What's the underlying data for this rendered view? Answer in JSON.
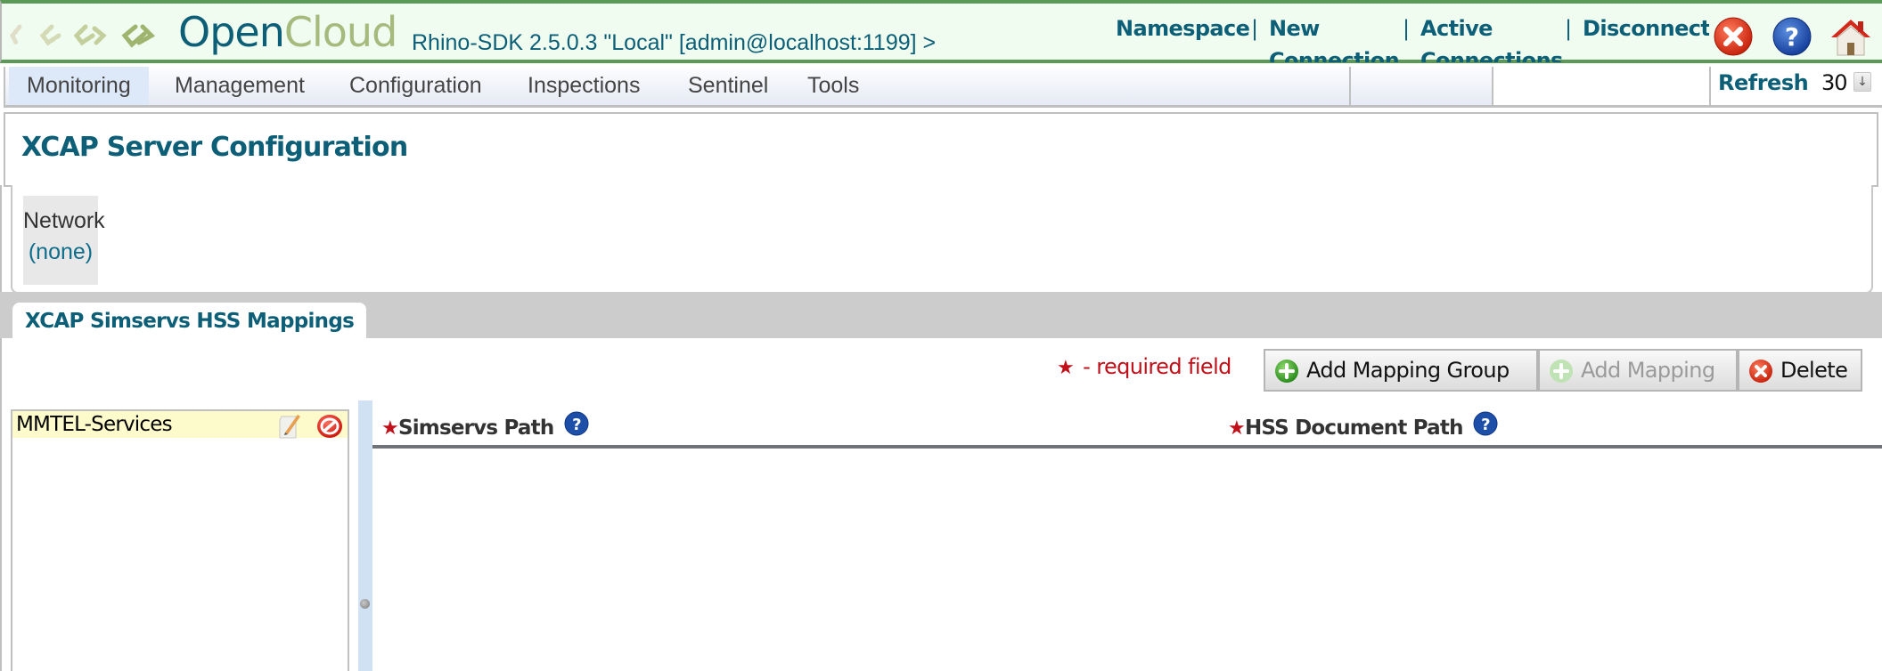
{
  "header": {
    "logo_open": "Open",
    "logo_cloud": "Cloud",
    "server_info": "Rhino-SDK 2.5.0.3 \"Local\" [admin@localhost:1199] >",
    "links": [
      {
        "label": "Namespace"
      },
      {
        "label": "New Connection"
      },
      {
        "label": "Active Connections"
      },
      {
        "label": "Disconnect"
      }
    ],
    "separator": "|",
    "icons": [
      "close-icon",
      "help-icon",
      "home-icon"
    ]
  },
  "nav": {
    "items": [
      {
        "label": "Monitoring",
        "active": true
      },
      {
        "label": "Management"
      },
      {
        "label": "Configuration"
      },
      {
        "label": "Inspections"
      },
      {
        "label": "Sentinel"
      },
      {
        "label": "Tools"
      }
    ],
    "refresh_label": "Refresh",
    "refresh_value": "30",
    "refresh_dropdown_glyph": "↓"
  },
  "page": {
    "title": "XCAP Server Configuration",
    "network_label": "Network",
    "network_value": "(none)"
  },
  "tabs": [
    {
      "label": "XCAP Simservs HSS Mappings",
      "active": true
    }
  ],
  "toolbar": {
    "required_star": "★",
    "required_note": "- required field",
    "buttons": [
      {
        "label": "Add Mapping Group",
        "icon": "plus-icon",
        "enabled": true
      },
      {
        "label": "Add Mapping",
        "icon": "plus-icon",
        "enabled": false
      },
      {
        "label": "Delete",
        "icon": "delete-icon",
        "enabled": true
      }
    ]
  },
  "groups": [
    {
      "name": "MMTEL-Services",
      "selected": true
    }
  ],
  "table": {
    "columns": [
      {
        "label": "Simservs Path",
        "required": true
      },
      {
        "label": "HSS Document Path",
        "required": true
      }
    ],
    "rows": []
  },
  "colors": {
    "brand_teal": "#0d5f78",
    "brand_green": "#5a9a56",
    "logo_cloud": "#a5bb7e",
    "required_red": "#c0101a",
    "selected_row": "#fdfacb"
  }
}
